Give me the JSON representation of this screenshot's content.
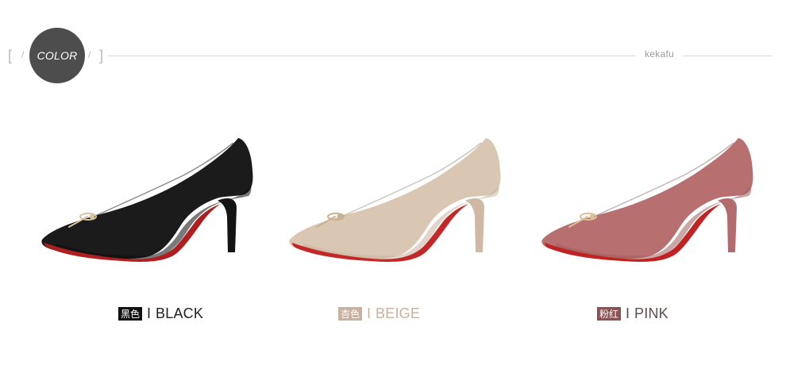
{
  "header": {
    "badge": "COLOR",
    "brand": "kekafu",
    "bracket_left": "[",
    "bracket_right": "]",
    "slash_left": "/",
    "slash_right": "/"
  },
  "variants": [
    {
      "chip": "黑色",
      "separator": "I",
      "name": "BLACK",
      "chip_color": "#111111",
      "text_color": "#1f1f1f",
      "shoe_color": "#1b1b1b",
      "shoe_shadow": "#0b0b0b",
      "heel_color": "#141414",
      "sole_color": "#b01f1f",
      "icon": "black-pump-shoe"
    },
    {
      "chip": "杏色",
      "separator": "I",
      "name": "BEIGE",
      "chip_color": "#c8b19e",
      "text_color": "#c8b19e",
      "shoe_color": "#d9c7b3",
      "shoe_shadow": "#c8b39d",
      "heel_color": "#d0b8a4",
      "sole_color": "#c42727",
      "icon": "beige-pump-shoe"
    },
    {
      "chip": "粉红",
      "separator": "I",
      "name": "PINK",
      "chip_color": "#8b5253",
      "text_color": "#5c4e4e",
      "shoe_color": "#b86f70",
      "shoe_shadow": "#9f5c5e",
      "heel_color": "#b26c6d",
      "sole_color": "#c12323",
      "icon": "pink-pump-shoe"
    }
  ]
}
